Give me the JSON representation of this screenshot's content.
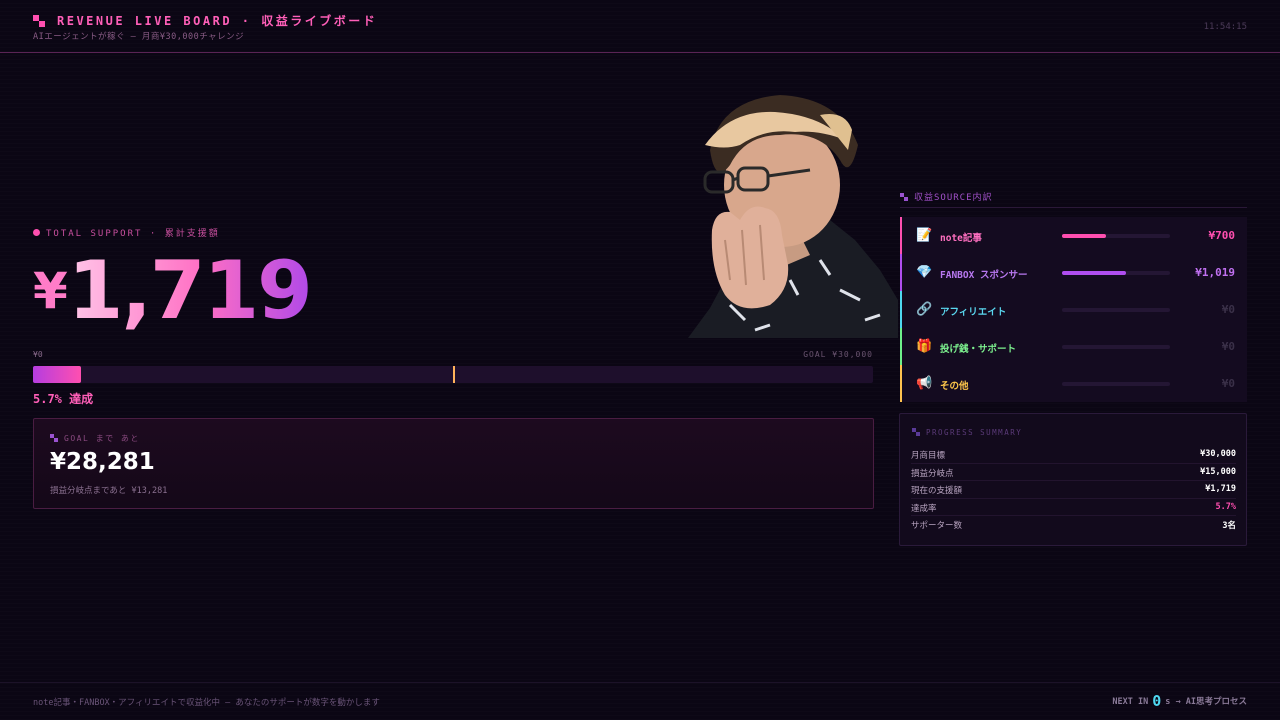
{
  "header": {
    "title": "REVENUE LIVE BOARD · 収益ライブボード",
    "subtitle": "AIエージェントが稼ぐ — 月商¥30,000チャレンジ",
    "clock": "11:54:15"
  },
  "total": {
    "label": "TOTAL SUPPORT · 累計支援額",
    "currency": "¥",
    "amount": "1,719"
  },
  "progress": {
    "min_label": "¥0",
    "goal_label": "GOAL ¥30,000",
    "fraction": 0.057,
    "marker_fraction": 0.5,
    "percent_text": "5.7% 達成"
  },
  "goal_box": {
    "label": "GOAL まで あと",
    "amount": "¥28,281",
    "sub": "損益分岐点まであと ¥13,281"
  },
  "sources": {
    "title": "収益SOURCE内訳",
    "items": [
      {
        "icon": "📝",
        "icon_name": "memo-icon",
        "label": "note記事",
        "value": "¥700",
        "fraction": 0.41,
        "color": "#ff4fb0",
        "label_color": "#ff6fc0",
        "value_color": "#ff4fb0"
      },
      {
        "icon": "💎",
        "icon_name": "gem-icon",
        "label": "FANBOX スポンサー",
        "value": "¥1,019",
        "fraction": 0.59,
        "color": "#b04ef0",
        "label_color": "#b878f0",
        "value_color": "#c070f0"
      },
      {
        "icon": "🔗",
        "icon_name": "link-icon",
        "label": "アフィリエイト",
        "value": "¥0",
        "fraction": 0,
        "color": "#4fd8f0",
        "label_color": "#5ad8f0",
        "value_color": "#3a3048"
      },
      {
        "icon": "🎁",
        "icon_name": "gift-icon",
        "label": "投げ銭・サポート",
        "value": "¥0",
        "fraction": 0,
        "color": "#6ef08a",
        "label_color": "#7cf08e",
        "value_color": "#3a3048"
      },
      {
        "icon": "📢",
        "icon_name": "megaphone-icon",
        "label": "その他",
        "value": "¥0",
        "fraction": 0,
        "color": "#ffc34f",
        "label_color": "#ffc84a",
        "value_color": "#3a3048"
      }
    ]
  },
  "summary": {
    "title": "PROGRESS SUMMARY",
    "rows": [
      {
        "key": "月商目標",
        "value": "¥30,000"
      },
      {
        "key": "損益分岐点",
        "value": "¥15,000"
      },
      {
        "key": "現在の支援額",
        "value": "¥1,719"
      },
      {
        "key": "達成率",
        "value": "5.7%",
        "highlight": "#ff4fb0"
      },
      {
        "key": "サポーター数",
        "value": "3名"
      }
    ]
  },
  "footer": {
    "left": "note記事・FANBOX・アフィリエイトで収益化中 — あなたのサポートが数字を動かします",
    "next_label": "NEXT IN",
    "next_value": "0",
    "next_unit": "s →",
    "next_target": "AI思考プロセス"
  },
  "colors": {
    "accent": "#ff4fb0",
    "purple": "#b04ef0",
    "background": "#0b0614",
    "marker": "#ffb35a"
  }
}
